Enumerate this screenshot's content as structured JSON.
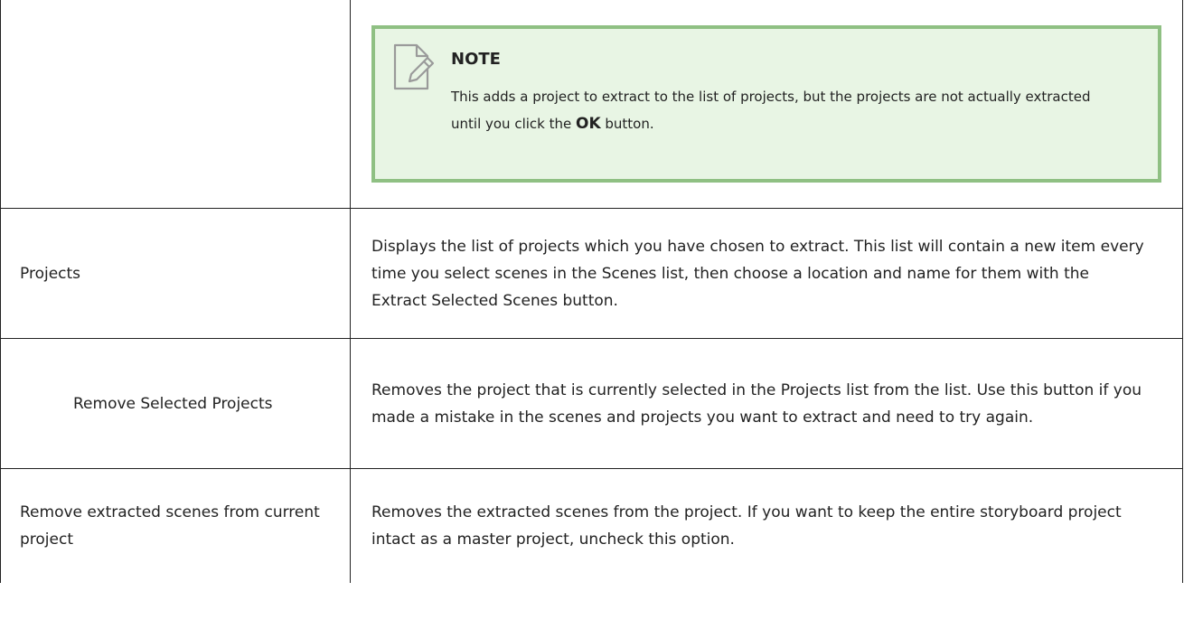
{
  "note": {
    "icon": "note-pencil-icon",
    "title": "NOTE",
    "body_before": "This adds a project to extract to the list of projects, but the projects are not actually extracted until you click the ",
    "body_bold": "OK",
    "body_after": " button."
  },
  "rows": [
    {
      "name": "Projects",
      "description": "Displays the list of projects which you have chosen to extract. This list will contain a new item every time you select scenes in the Scenes list, then choose a location and name for them with the Extract Selected Scenes button."
    },
    {
      "name": "Remove Selected Projects",
      "description": "Removes the project that is currently selected in the Projects list from the list. Use this button if you made a mistake in the scenes and projects you want to extract and need to try again."
    },
    {
      "name": "Remove extracted scenes from current project",
      "description": "Removes the extracted scenes from the project. If you want to keep the entire storyboard project intact as a master project, uncheck this option."
    }
  ],
  "colors": {
    "note_background": "#e8f5e4",
    "note_border": "#8fc083",
    "table_border": "#222222"
  }
}
